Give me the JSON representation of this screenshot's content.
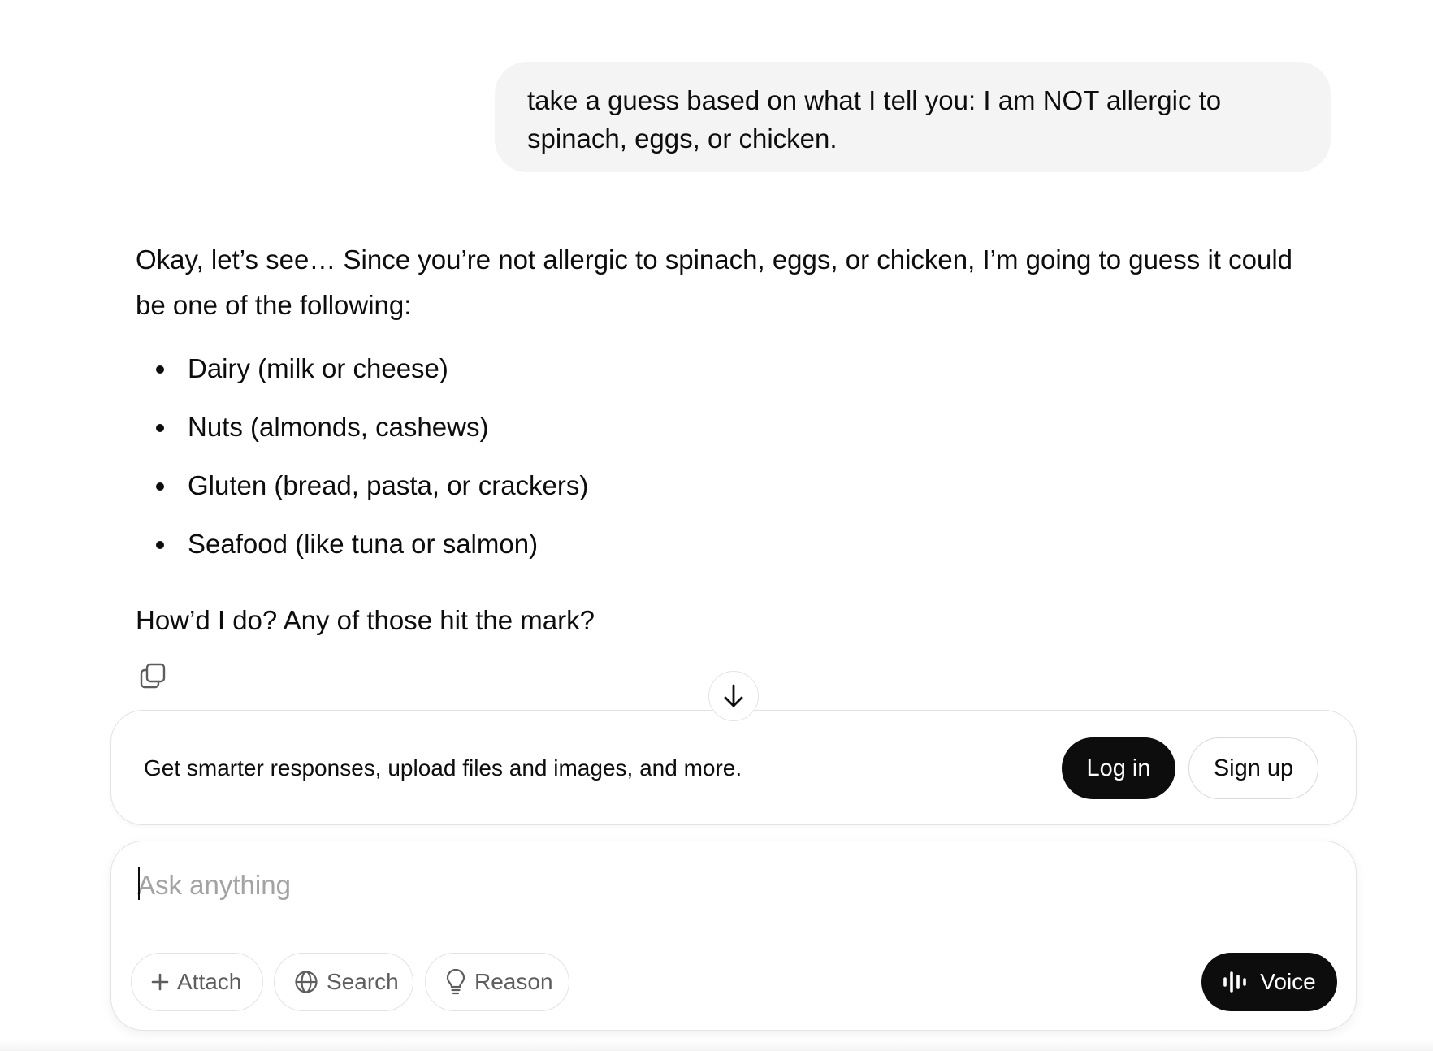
{
  "user_message": {
    "text": "take a guess based on what I tell you: I am NOT allergic to spinach, eggs, or chicken."
  },
  "assistant_message": {
    "intro": "Okay, let’s see… Since you’re not allergic to spinach, eggs, or chicken, I’m going to guess it could be one of the following:",
    "items": [
      "Dairy (milk or cheese)",
      "Nuts (almonds, cashews)",
      "Gluten (bread, pasta, or crackers)",
      "Seafood (like tuna or salmon)"
    ],
    "closing": "How’d I do? Any of those hit the mark?",
    "actions": {
      "copy_icon": "copy-icon"
    }
  },
  "scroll_button": {
    "icon": "arrow-down-icon"
  },
  "login_banner": {
    "text": "Get smarter responses, upload files and images, and more.",
    "login_label": "Log in",
    "signup_label": "Sign up"
  },
  "composer": {
    "placeholder": "Ask anything",
    "value": "",
    "attach_label": "Attach",
    "search_label": "Search",
    "reason_label": "Reason",
    "voice_label": "Voice",
    "icons": {
      "attach": "plus-icon",
      "search": "globe-icon",
      "reason": "lightbulb-icon",
      "voice": "audio-waveform-icon"
    }
  },
  "colors": {
    "text": "#0d0d0d",
    "user_bubble_bg": "#f4f4f4",
    "primary_button_bg": "#0d0d0d",
    "border": "#e3e3e3",
    "placeholder": "#a3a3a3",
    "secondary_text": "#5d5d5d"
  }
}
